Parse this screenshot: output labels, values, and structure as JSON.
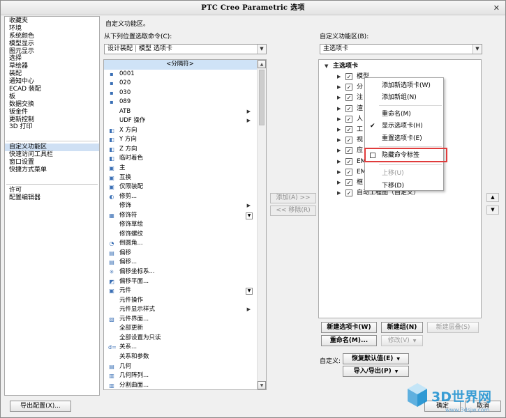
{
  "window": {
    "title": "PTC Creo Parametric 选项",
    "close": "✕"
  },
  "nav": {
    "group1": [
      "收藏夹",
      "环境",
      "系统颜色",
      "模型显示",
      "图元显示",
      "选择",
      "草绘器",
      "装配",
      "通知中心",
      "ECAD 装配",
      "板",
      "数据交换",
      "钣金件",
      "更新控制",
      "3D 打印"
    ],
    "group2": [
      "自定义功能区",
      "快速访问工具栏",
      "窗口设置",
      "快捷方式菜单"
    ],
    "group3": [
      "许可",
      "配置编辑器"
    ],
    "selected": "自定义功能区"
  },
  "header": {
    "heading": "自定义功能区。"
  },
  "source": {
    "label": "从下列位置选取命令(C):",
    "combo_part1": "设计装配",
    "combo_part2": "模型 选项卡"
  },
  "commands": [
    {
      "label": "<分隔符>",
      "icon": "",
      "selected": true
    },
    {
      "label": "0001",
      "icon": "▪"
    },
    {
      "label": "020",
      "icon": "▪"
    },
    {
      "label": "030",
      "icon": "▪"
    },
    {
      "label": "089",
      "icon": "▪"
    },
    {
      "label": "ATB",
      "icon": "",
      "submenu": true
    },
    {
      "label": "UDF 操作",
      "icon": "",
      "submenu": true
    },
    {
      "label": "X 方向",
      "icon": "◧"
    },
    {
      "label": "Y 方向",
      "icon": "◧"
    },
    {
      "label": "Z 方向",
      "icon": "◧"
    },
    {
      "label": "临时着色",
      "icon": "◧"
    },
    {
      "label": "主",
      "icon": "▣"
    },
    {
      "label": "互换",
      "icon": "▣"
    },
    {
      "label": "仅限装配",
      "icon": "▣"
    },
    {
      "label": "修剪...",
      "icon": "◐"
    },
    {
      "label": "修饰",
      "icon": "",
      "submenu": true
    },
    {
      "label": "修饰符",
      "icon": "▦",
      "dropdown": true
    },
    {
      "label": "修饰草绘",
      "icon": ""
    },
    {
      "label": "修饰螺纹",
      "icon": ""
    },
    {
      "label": "倒圆角...",
      "icon": "◔"
    },
    {
      "label": "偏移",
      "icon": "▤"
    },
    {
      "label": "偏移...",
      "icon": "▤"
    },
    {
      "label": "偏移坐标系...",
      "icon": "✳"
    },
    {
      "label": "偏移平面...",
      "icon": "◩"
    },
    {
      "label": "元件",
      "icon": "▣",
      "dropdown": true
    },
    {
      "label": "元件操作",
      "icon": ""
    },
    {
      "label": "元件显示样式",
      "icon": "",
      "submenu": true
    },
    {
      "label": "元件界面...",
      "icon": "▧"
    },
    {
      "label": "全部更新",
      "icon": ""
    },
    {
      "label": "全部设置为只读",
      "icon": ""
    },
    {
      "label": "关系...",
      "icon": "d="
    },
    {
      "label": "关系和参数",
      "icon": ""
    },
    {
      "label": "几何",
      "icon": "▤"
    },
    {
      "label": "几何阵列...",
      "icon": "▥"
    },
    {
      "label": "分割曲面...",
      "icon": "▥"
    }
  ],
  "mid_buttons": {
    "add": "添加(A) >>",
    "remove": "<< 移除(R)"
  },
  "target": {
    "label": "自定义功能区(B):",
    "combo": "主选项卡",
    "root": "主选项卡",
    "items": [
      "模型",
      "分",
      "注",
      "渲",
      "人",
      "工",
      "视",
      "应",
      "EM",
      "EM",
      "框",
      "自动工程图（自定义）"
    ]
  },
  "context_menu": {
    "items": [
      "添加新选项卡(W)",
      "添加新组(N)",
      "重命名(M)",
      "显示选项卡(H)",
      "重置选项卡(E)",
      "隐藏命令标签",
      "上移(U)",
      "下移(D)"
    ],
    "checked": "显示选项卡(H)",
    "highlighted": "隐藏命令标签",
    "disabled": [
      "上移(U)"
    ]
  },
  "side_buttons": {
    "up": "▲",
    "down": "▼"
  },
  "bottom_buttons": {
    "new_tab": "新建选项卡(W)",
    "new_group": "新建组(N)",
    "new_cascade": "新建层叠(S)",
    "rename": "重命名(M)...",
    "modify": "修改(V)",
    "customize_label": "自定义:",
    "restore_defaults": "恢复默认值(E)",
    "import_export": "导入/导出(P)",
    "export_config": "导出配置(X)...",
    "ok": "确定",
    "cancel": "取消"
  },
  "watermark": {
    "text": "3D世界网",
    "url": "www.3dsjw.com"
  },
  "colors": {
    "selection": "#cfe0f4",
    "highlight_border": "#e03c3c",
    "watermark": "#1a8fd0"
  }
}
